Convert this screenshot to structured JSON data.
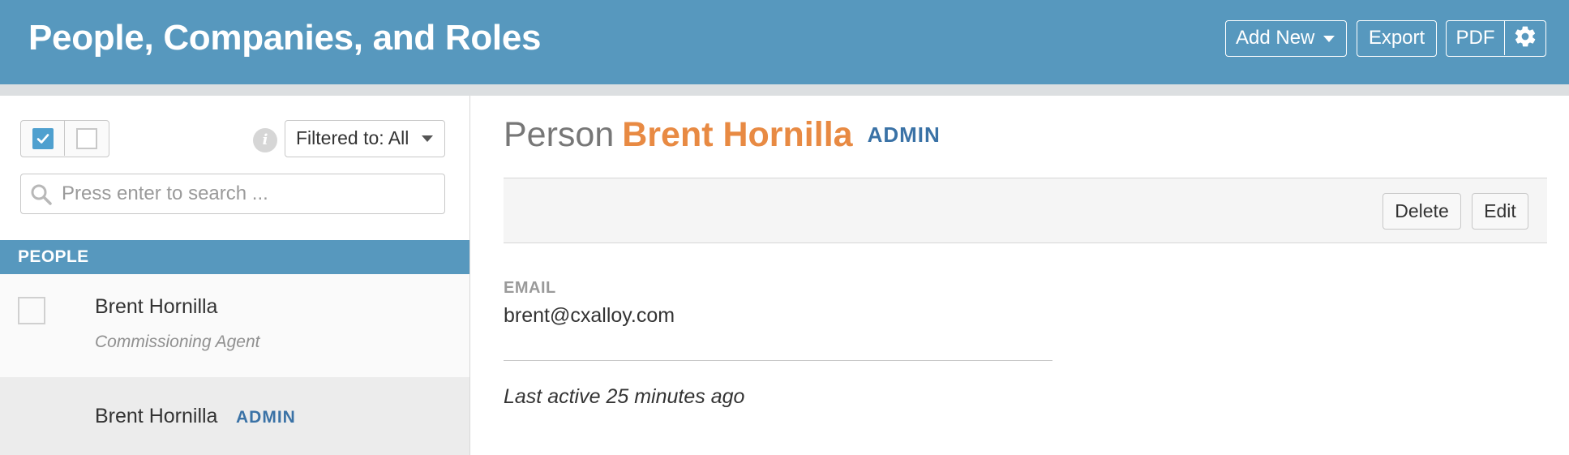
{
  "header": {
    "title": "People, Companies, and Roles",
    "buttons": {
      "add_new": "Add New",
      "export": "Export",
      "pdf": "PDF"
    },
    "background_color": "#5798be"
  },
  "sidebar": {
    "filter_label": "Filtered to: All",
    "search_placeholder": "Press enter to search ...",
    "section_header": "PEOPLE",
    "people": [
      {
        "name": "Brent Hornilla",
        "role": "Commissioning Agent",
        "badge": ""
      },
      {
        "name": "Brent Hornilla",
        "role": "",
        "badge": "ADMIN"
      }
    ]
  },
  "main": {
    "type_label": "Person",
    "name": "Brent Hornilla",
    "badge": "ADMIN",
    "actions": {
      "delete": "Delete",
      "edit": "Edit"
    },
    "email_label": "EMAIL",
    "email_value": "brent@cxalloy.com",
    "last_active": "Last active 25 minutes ago"
  },
  "colors": {
    "accent_blue": "#5798be",
    "name_orange": "#e88a43",
    "badge_blue": "#3a72a6"
  }
}
